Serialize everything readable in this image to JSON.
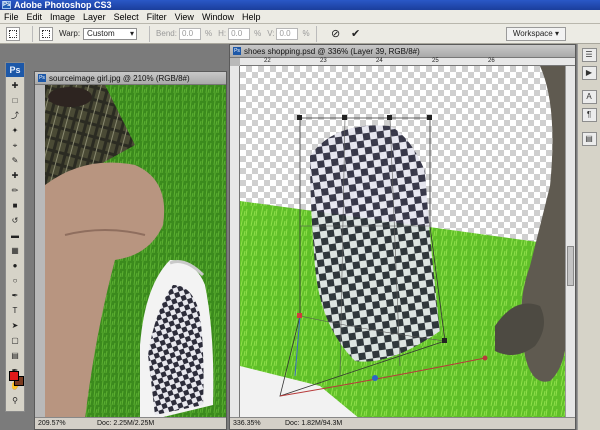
{
  "app": {
    "title": "Adobe Photoshop CS3",
    "logo": "Ps"
  },
  "menu": [
    "File",
    "Edit",
    "Image",
    "Layer",
    "Select",
    "Filter",
    "View",
    "Window",
    "Help"
  ],
  "options": {
    "warp_label": "Warp:",
    "warp_value": "Custom",
    "bend_label": "Bend:",
    "bend_value": "0.0",
    "pct": "%",
    "h_label": "H:",
    "h_value": "0.0",
    "v_label": "V:",
    "v_value": "0.0",
    "workspace": "Workspace ▾"
  },
  "docs": [
    {
      "title": "sourceimage girl.jpg @ 210% (RGB/8#)",
      "zoom": "209.57%",
      "info": "Doc: 2.25M/2.25M"
    },
    {
      "title": "shoes shopping.psd @ 336% (Layer 39, RGB/8#)",
      "zoom": "336.35%",
      "info": "Doc: 1.82M/94.3M"
    }
  ],
  "ruler_ticks": [
    "22",
    "23",
    "24",
    "25",
    "26"
  ],
  "icons": {
    "tools": [
      "move-icon",
      "marquee-icon",
      "lasso-icon",
      "magic-wand-icon",
      "crop-icon",
      "slice-icon",
      "healing-icon",
      "brush-icon",
      "stamp-icon",
      "history-brush-icon",
      "eraser-icon",
      "gradient-icon",
      "blur-icon",
      "dodge-icon",
      "pen-icon",
      "type-icon",
      "path-select-icon",
      "shape-icon",
      "notes-icon",
      "eyedropper-icon",
      "hand-icon",
      "zoom-icon"
    ],
    "dock": [
      "history-panel-icon",
      "actions-panel-icon",
      "character-panel-icon",
      "paragraph-panel-icon",
      "layers-panel-icon"
    ]
  },
  "colors": {
    "foreground": "#e11919",
    "background": "#7a3a1f"
  }
}
